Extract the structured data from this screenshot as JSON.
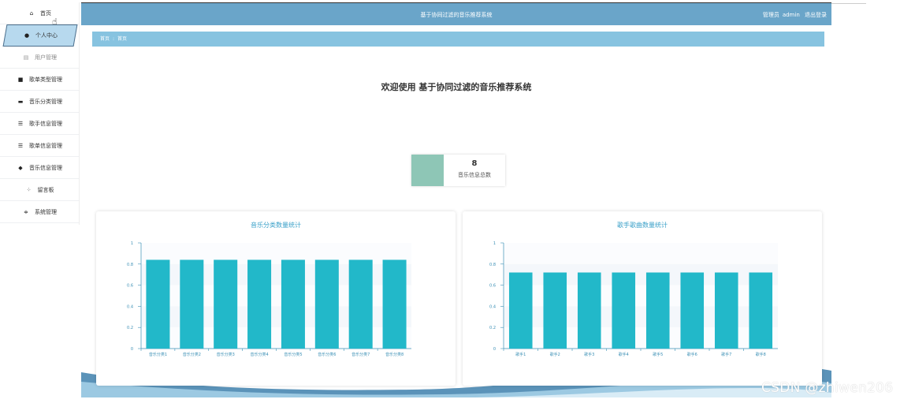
{
  "sidebar": {
    "items": [
      {
        "label": "首页",
        "icon": "home-icon",
        "glyph": "⌂"
      },
      {
        "label": "个人中心",
        "icon": "user-icon",
        "glyph": "●"
      },
      {
        "label": "用户管理",
        "icon": "bank-icon",
        "glyph": "▤"
      },
      {
        "label": "歌单类型管理",
        "icon": "book-icon",
        "glyph": "■"
      },
      {
        "label": "音乐分类管理",
        "icon": "monitor-icon",
        "glyph": "▬"
      },
      {
        "label": "歌手信息管理",
        "icon": "list-icon",
        "glyph": "☰"
      },
      {
        "label": "歌单信息管理",
        "icon": "list-icon",
        "glyph": "☰"
      },
      {
        "label": "音乐信息管理",
        "icon": "disk-icon",
        "glyph": "◆"
      },
      {
        "label": "留言板",
        "icon": "grid-icon",
        "glyph": "⁘"
      },
      {
        "label": "系统管理",
        "icon": "sliders-icon",
        "glyph": "≑"
      }
    ]
  },
  "header": {
    "title": "基于协同过滤的音乐推荐系统",
    "role": "管理员",
    "user": "admin",
    "logout": "退出登录"
  },
  "breadcrumb": {
    "root": "首页",
    "sep": ":",
    "current": "首页"
  },
  "welcome": "欢迎使用 基于协同过滤的音乐推荐系统",
  "stat": {
    "value": "8",
    "label": "音乐信息总数"
  },
  "colors": {
    "accent": "#6aa5c9",
    "bar": "#22b8c9",
    "crumb": "#87c3e0",
    "swatch": "#8ec6b6"
  },
  "chart_data": [
    {
      "type": "bar",
      "title": "音乐分类数量统计",
      "categories": [
        "音乐分类1",
        "音乐分类2",
        "音乐分类3",
        "音乐分类4",
        "音乐分类5",
        "音乐分类6",
        "音乐分类7",
        "音乐分类8"
      ],
      "values": [
        1,
        1,
        1,
        1,
        1,
        1,
        1,
        1
      ],
      "ylim": [
        0,
        1
      ],
      "yticks": [
        "0",
        "0.2",
        "0.4",
        "0.6",
        "0.8",
        "1"
      ]
    },
    {
      "type": "bar",
      "title": "歌手歌曲数量统计",
      "categories": [
        "歌手1",
        "歌手2",
        "歌手3",
        "歌手4",
        "歌手5",
        "歌手6",
        "歌手7",
        "歌手8"
      ],
      "values": [
        1,
        1,
        1,
        1,
        1,
        1,
        1,
        1
      ],
      "ylim": [
        0,
        1
      ],
      "yticks": [
        "0",
        "0.2",
        "0.4",
        "0.6",
        "0.8",
        "1"
      ]
    }
  ],
  "watermark": "CSDN @zhiwen206"
}
